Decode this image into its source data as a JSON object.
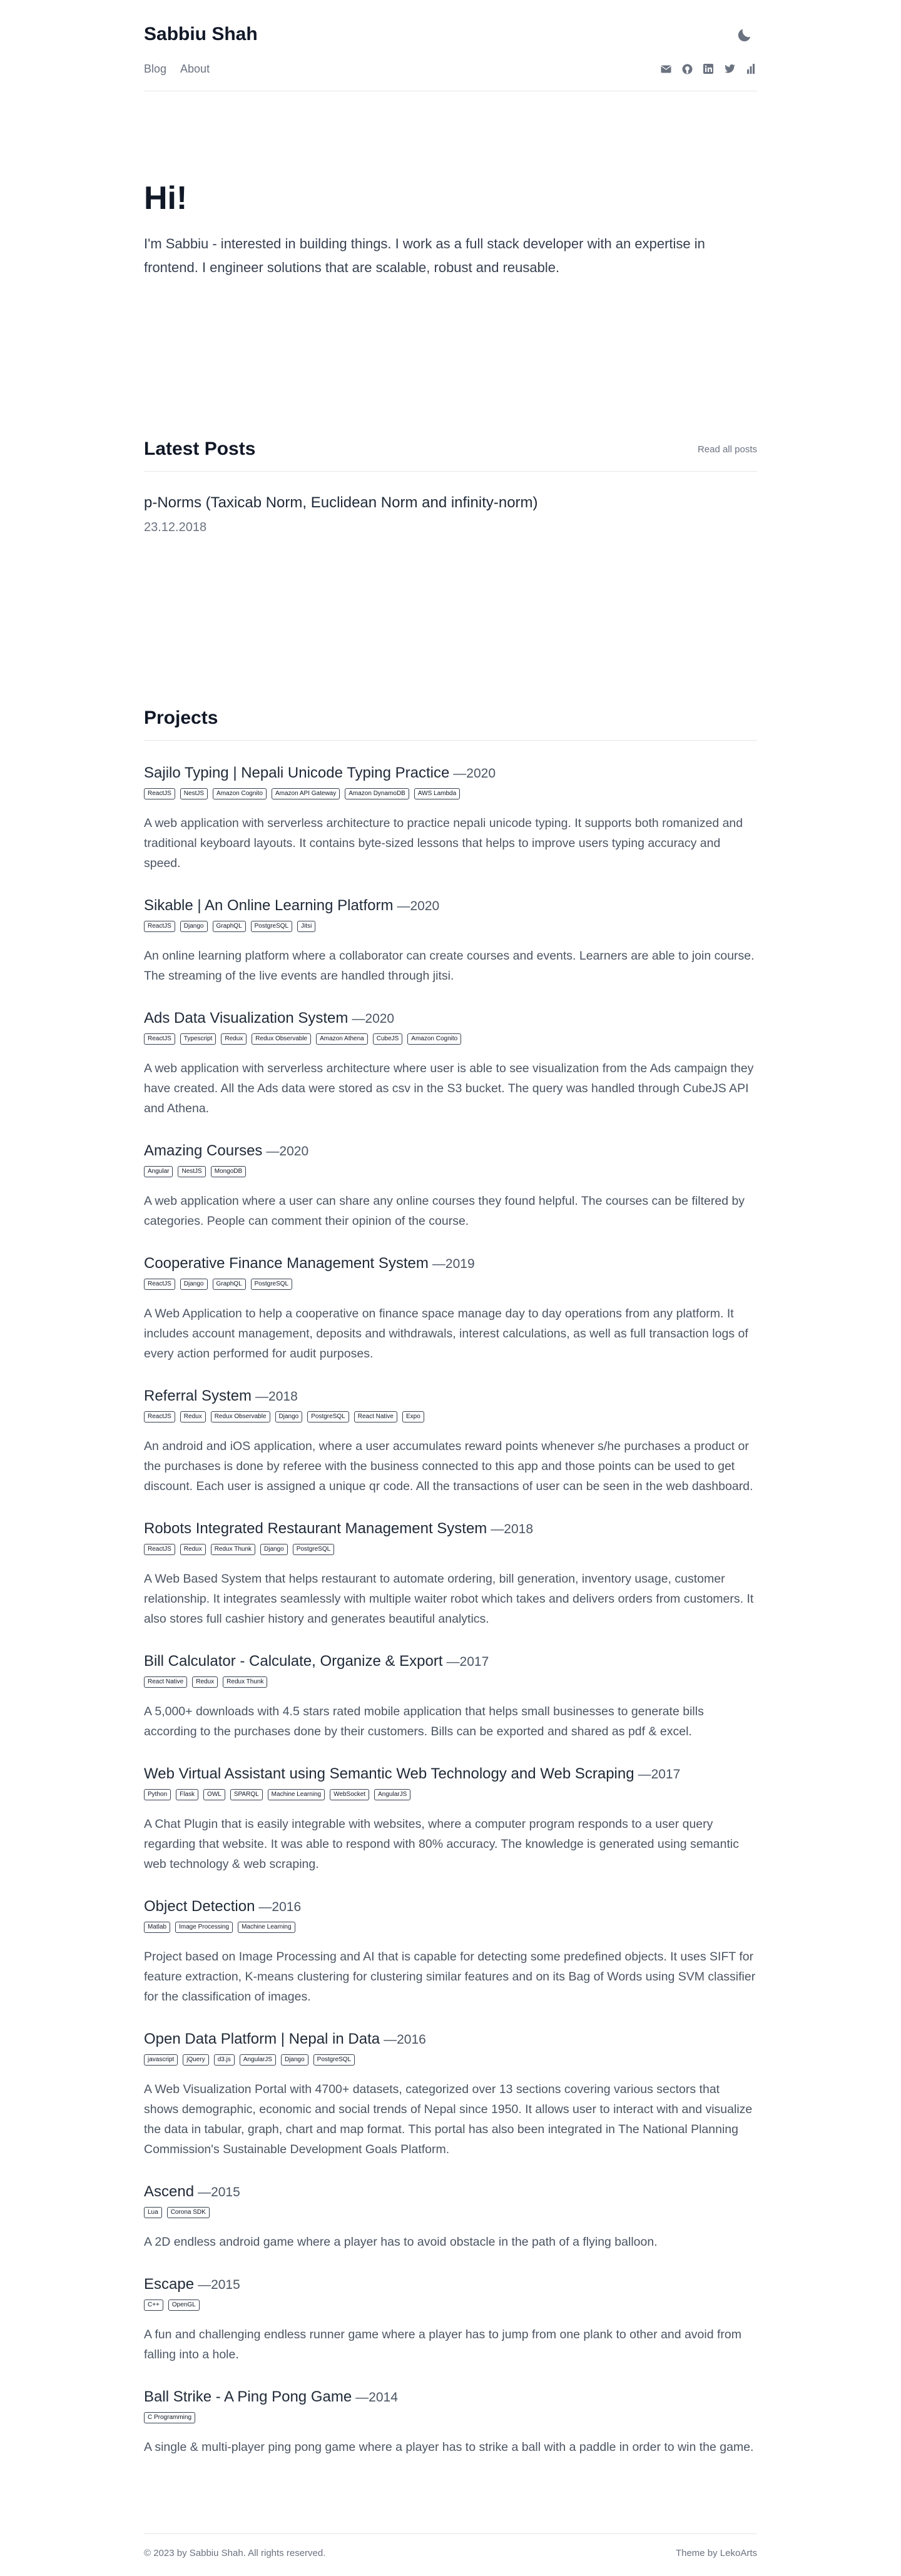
{
  "header": {
    "site_title": "Sabbiu Shah",
    "nav": [
      "Blog",
      "About"
    ],
    "icons": [
      "moon-icon",
      "mail-icon",
      "github-icon",
      "linkedin-icon",
      "twitter-icon",
      "stats-icon"
    ]
  },
  "hero": {
    "heading": "Hi!",
    "intro": "I'm Sabbiu - interested in building things. I work as a full stack developer with an expertise in frontend. I engineer solutions that are scalable, robust and reusable."
  },
  "posts": {
    "heading": "Latest Posts",
    "read_all": "Read all posts",
    "items": [
      {
        "title": "p-Norms (Taxicab Norm, Euclidean Norm and infinity-norm)",
        "date": "23.12.2018"
      }
    ]
  },
  "projects": {
    "heading": "Projects",
    "items": [
      {
        "title": "Sajilo Typing | Nepali Unicode Typing Practice",
        "year": "—2020",
        "tags": [
          "ReactJS",
          "NestJS",
          "Amazon Cognito",
          "Amazon API Gateway",
          "Amazon DynamoDB",
          "AWS Lambda"
        ],
        "desc": "A web application with serverless architecture to practice nepali unicode typing. It supports both romanized and traditional keyboard layouts. It contains byte-sized lessons that helps to improve users typing accuracy and speed."
      },
      {
        "title": "Sikable | An Online Learning Platform",
        "year": "—2020",
        "tags": [
          "ReactJS",
          "Django",
          "GraphQL",
          "PostgreSQL",
          "Jitsi"
        ],
        "desc": "An online learning platform where a collaborator can create courses and events. Learners are able to join course. The streaming of the live events are handled through jitsi."
      },
      {
        "title": "Ads Data Visualization System",
        "year": "—2020",
        "tags": [
          "ReactJS",
          "Typescript",
          "Redux",
          "Redux Observable",
          "Amazon Athena",
          "CubeJS",
          "Amazon Cognito"
        ],
        "desc": "A web application with serverless architecture where user is able to see visualization from the Ads campaign they have created. All the Ads data were stored as csv in the S3 bucket. The query was handled through CubeJS API and Athena."
      },
      {
        "title": "Amazing Courses",
        "year": "—2020",
        "tags": [
          "Angular",
          "NestJS",
          "MongoDB"
        ],
        "desc": "A web application where a user can share any online courses they found helpful. The courses can be filtered by categories. People can comment their opinion of the course."
      },
      {
        "title": "Cooperative Finance Management System",
        "year": "—2019",
        "tags": [
          "ReactJS",
          "Django",
          "GraphQL",
          "PostgreSQL"
        ],
        "desc": "A Web Application to help a cooperative on finance space manage day to day operations from any platform. It includes account management, deposits and withdrawals, interest calculations, as well as full transaction logs of every action performed for audit purposes."
      },
      {
        "title": "Referral System",
        "year": "—2018",
        "tags": [
          "ReactJS",
          "Redux",
          "Redux Observable",
          "Django",
          "PostgreSQL",
          "React Native",
          "Expo"
        ],
        "desc": "An android and iOS application, where a user accumulates reward points whenever s/he purchases a product or the purchases is done by referee with the business connected to this app and those points can be used to get discount. Each user is assigned a unique qr code. All the transactions of user can be seen in the web dashboard."
      },
      {
        "title": "Robots Integrated Restaurant Management System",
        "year": "—2018",
        "tags": [
          "ReactJS",
          "Redux",
          "Redux Thunk",
          "Django",
          "PostgreSQL"
        ],
        "desc": "A Web Based System that helps restaurant to automate ordering, bill generation, inventory usage, customer relationship. It integrates seamlessly with multiple waiter robot which takes and delivers orders from customers. It also stores full cashier history and generates beautiful analytics."
      },
      {
        "title": "Bill Calculator - Calculate, Organize & Export",
        "year": "—2017",
        "tags": [
          "React Native",
          "Redux",
          "Redux Thunk"
        ],
        "desc": "A 5,000+ downloads with 4.5 stars rated mobile application that helps small businesses to generate bills according to the purchases done by their customers. Bills can be exported and shared as pdf & excel."
      },
      {
        "title": "Web Virtual Assistant using Semantic Web Technology and Web Scraping",
        "year": "—2017",
        "tags": [
          "Python",
          "Flask",
          "OWL",
          "SPARQL",
          "Machine Learning",
          "WebSocket",
          "AngularJS"
        ],
        "desc": "A Chat Plugin that is easily integrable with websites, where a computer program responds to a user query regarding that website. It was able to respond with 80% accuracy. The knowledge is generated using semantic web technology & web scraping."
      },
      {
        "title": "Object Detection",
        "year": "—2016",
        "tags": [
          "Matlab",
          "Image Processing",
          "Machine Learning"
        ],
        "desc": "Project based on Image Processing and AI that is capable for detecting some predefined objects. It uses SIFT for feature extraction, K-means clustering for clustering similar features and on its Bag of Words using SVM classifier for the classification of images."
      },
      {
        "title": "Open Data Platform | Nepal in Data",
        "year": "—2016",
        "tags": [
          "javascript",
          "jQuery",
          "d3.js",
          "AngularJS",
          "Django",
          "PostgreSQL"
        ],
        "desc": "A Web Visualization Portal with 4700+ datasets, categorized over 13 sections covering various sectors that shows demographic, economic and social trends of Nepal since 1950. It allows user to interact with and visualize the data in tabular, graph, chart and map format. This portal has also been integrated in The National Planning Commission's Sustainable Development Goals Platform."
      },
      {
        "title": "Ascend",
        "year": "—2015",
        "tags": [
          "Lua",
          "Corona SDK"
        ],
        "desc": "A 2D endless android game where a player has to avoid obstacle in the path of a flying balloon."
      },
      {
        "title": "Escape",
        "year": "—2015",
        "tags": [
          "C++",
          "OpenGL"
        ],
        "desc": "A fun and challenging endless runner game where a player has to jump from one plank to other and avoid from falling into a hole."
      },
      {
        "title": "Ball Strike - A Ping Pong Game",
        "year": "—2014",
        "tags": [
          "C Programming"
        ],
        "desc": "A single & multi-player ping pong game where a player has to strike a ball with a paddle in order to win the game."
      }
    ]
  },
  "footer": {
    "copyright": "© 2023 by Sabbiu Shah. All rights reserved.",
    "theme": "Theme by LekoArts"
  }
}
